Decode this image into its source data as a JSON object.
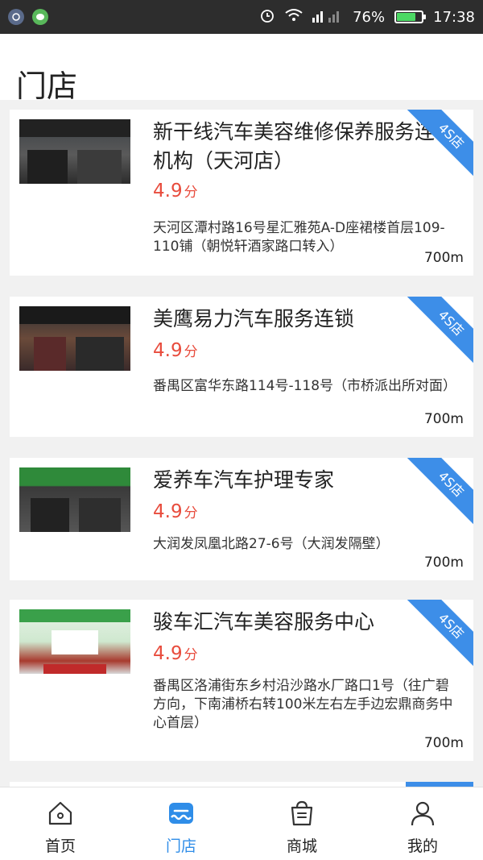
{
  "status_bar": {
    "battery": "76%",
    "battery_level": 0.76,
    "time": "17:38"
  },
  "header": {
    "title": "门店"
  },
  "stores": [
    {
      "name": "新干线汽车美容维修保养服务连锁机构（天河店）",
      "rating": "4.9",
      "rating_unit": "分",
      "address": "天河区潭村路16号星汇雅苑A-D座裙楼首层109-110铺（朝悦轩酒家路口转入）",
      "distance": "700m",
      "badge": "4S店"
    },
    {
      "name": "美鹰易力汽车服务连锁",
      "rating": "4.9",
      "rating_unit": "分",
      "address": "番禺区富华东路114号-118号（市桥派出所对面）",
      "distance": "700m",
      "badge": "4S店"
    },
    {
      "name": "爱养车汽车护理专家",
      "rating": "4.9",
      "rating_unit": "分",
      "address": "大润发凤凰北路27-6号（大润发隔壁）",
      "distance": "700m",
      "badge": "4S店"
    },
    {
      "name": "骏车汇汽车美容服务中心",
      "rating": "4.9",
      "rating_unit": "分",
      "address": "番禺区洛浦街东乡村沿沙路水厂路口1号（往广碧方向，下南浦桥右转100米左右左手边宏鼎商务中心首层）",
      "distance": "700m",
      "badge": "4S店"
    }
  ],
  "tabs": [
    {
      "label": "首页",
      "icon": "home-icon"
    },
    {
      "label": "门店",
      "icon": "store-icon"
    },
    {
      "label": "商城",
      "icon": "shopping-bag-icon"
    },
    {
      "label": "我的",
      "icon": "user-icon"
    }
  ],
  "colors": {
    "accent": "#2f8de8",
    "badge": "#3d8ee8",
    "rating": "#e84c3d"
  }
}
